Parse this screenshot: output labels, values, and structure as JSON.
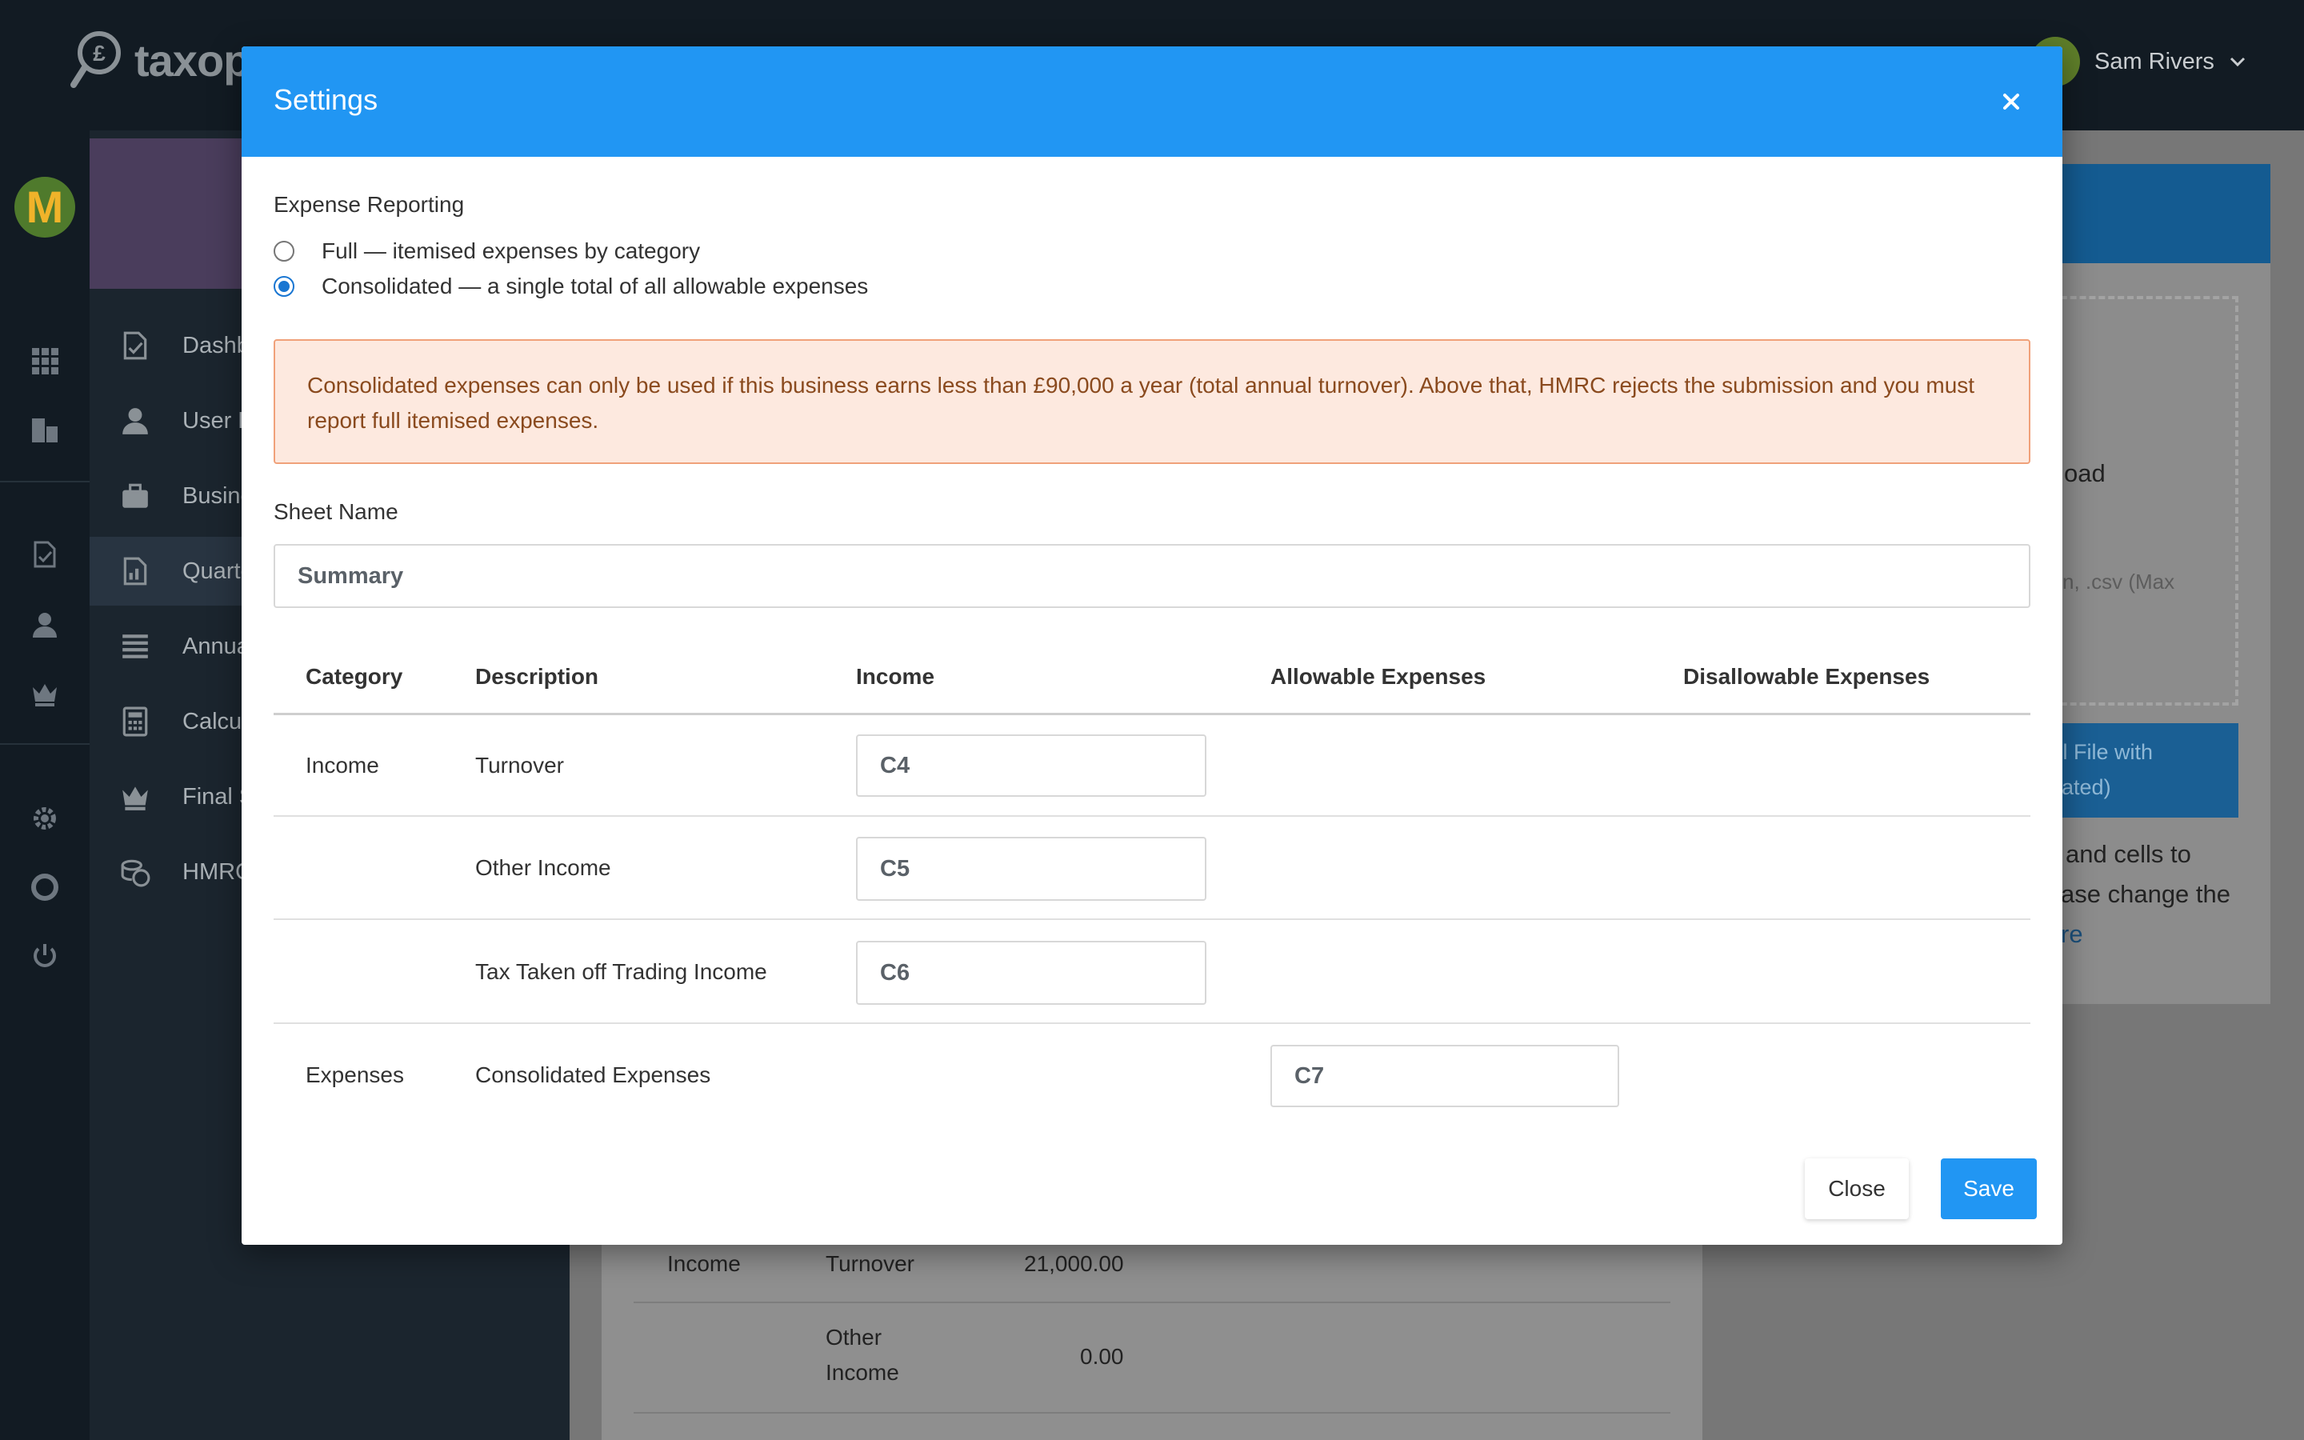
{
  "app": {
    "logo_text": "taxop",
    "user_name": "Sam Rivers",
    "rail_avatar_letter": "M"
  },
  "sidebar": {
    "items": [
      {
        "label": "Dashb",
        "icon": "document-check-icon"
      },
      {
        "label": "User D",
        "icon": "user-icon"
      },
      {
        "label": "Busine",
        "icon": "briefcase-icon"
      },
      {
        "label": "Quarte",
        "icon": "report-icon"
      },
      {
        "label": "Annua",
        "icon": "list-calendar-icon"
      },
      {
        "label": "Calcul",
        "icon": "calculator-icon"
      },
      {
        "label": "Final S",
        "icon": "crown-icon"
      },
      {
        "label": "HMRC",
        "icon": "coins-icon"
      }
    ]
  },
  "background": {
    "upload_text": "oad",
    "upload_hint": "n, .csv (Max",
    "upload_button_line1": "cel File with",
    "upload_button_line2": "lidated)",
    "help_line1": "and cells to",
    "help_line2": "ase change the",
    "help_link": "re",
    "table_rows": [
      {
        "category": "Income",
        "description": "Turnover",
        "value": "21,000.00"
      },
      {
        "category": "",
        "description_line1": "Other",
        "description_line2": "Income",
        "value": "0.00"
      }
    ]
  },
  "modal": {
    "title": "Settings",
    "expense_reporting": {
      "label": "Expense Reporting",
      "options": [
        {
          "label": "Full — itemised expenses by category",
          "checked": false
        },
        {
          "label": "Consolidated — a single total of all allowable expenses",
          "checked": true
        }
      ]
    },
    "alert_text": "Consolidated expenses can only be used if this business earns less than £90,000 a year (total annual turnover). Above that, HMRC rejects the submission and you must report full itemised expenses.",
    "sheet_name": {
      "label": "Sheet Name",
      "value": "Summary"
    },
    "table": {
      "headers": [
        "Category",
        "Description",
        "Income",
        "Allowable Expenses",
        "Disallowable Expenses"
      ],
      "rows": [
        {
          "category": "Income",
          "description": "Turnover",
          "income": "C4"
        },
        {
          "category": "",
          "description": "Other Income",
          "income": "C5"
        },
        {
          "category": "",
          "description": "Tax Taken off Trading Income",
          "income": "C6"
        },
        {
          "category": "Expenses",
          "description": "Consolidated Expenses",
          "allowable": "C7"
        }
      ]
    },
    "close_label": "Close",
    "save_label": "Save"
  },
  "colors": {
    "accent": "#2196f3",
    "alert_bg": "#fde9df",
    "alert_border": "#f0a17a",
    "alert_text": "#8a4a1e"
  }
}
